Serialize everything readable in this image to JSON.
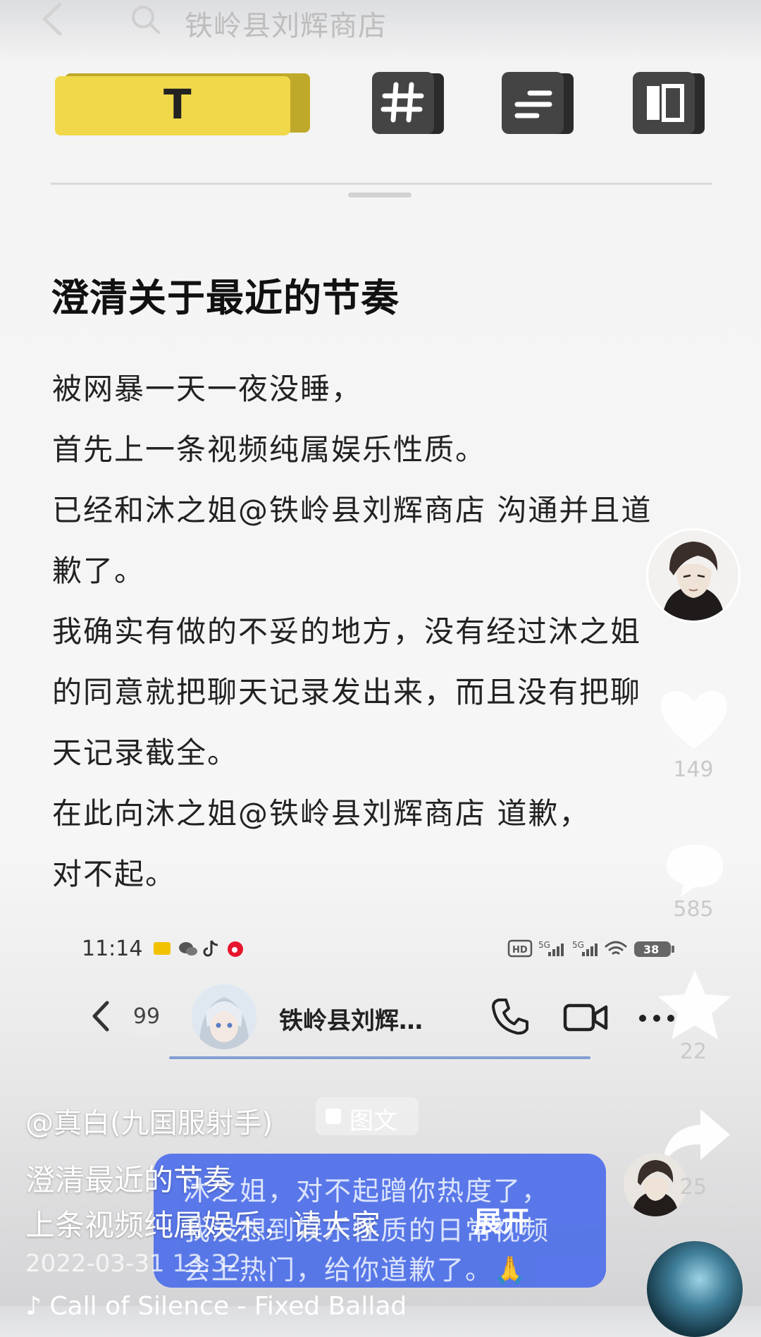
{
  "search": {
    "query": "铁岭县刘辉商店"
  },
  "toolbar": {
    "text_tool_label": "T",
    "icons": [
      "text-style-icon",
      "hashtag-icon",
      "align-icon",
      "layout-icon"
    ],
    "active_color": "#f0d84a"
  },
  "note": {
    "title": "澄清关于最近的节奏",
    "lines": [
      "被网暴一天一夜没睡，",
      "首先上一条视频纯属娱乐性质。",
      "已经和沐之姐@铁岭县刘辉商店 沟通并且道",
      "歉了。",
      "我确实有做的不妥的地方，没有经过沐之姐",
      "的同意就把聊天记录发出来，而且没有把聊",
      "天记录截全。",
      "在此向沐之姐@铁岭县刘辉商店 道歉，",
      "对不起。"
    ]
  },
  "rail": {
    "likes": "149",
    "comments": "585",
    "favorites": "22",
    "shares": "25"
  },
  "embedded_chat": {
    "status_time": "11:14",
    "battery": "38",
    "unread": "99",
    "contact_name": "铁岭县刘辉…",
    "bubble_lines": [
      "沐之姐，对不起蹭你热度了，",
      "我没想到娱乐性质的日常视频",
      "会上热门，给你道歉了。🙏"
    ],
    "bubble_color": "#4e6fe9"
  },
  "caption": {
    "author": "@真白(九国服射手)",
    "badge": "图文",
    "line1": "澄清最近的节奏",
    "line2": "上条视频纯属娱乐，请大家",
    "expand": "展开",
    "date": "2022-03-31 13:32",
    "music": "♪ Call of Silence - Fixed Ballad"
  }
}
